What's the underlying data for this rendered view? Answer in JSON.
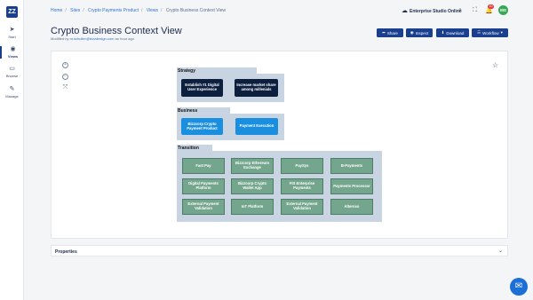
{
  "brand": {
    "logo": "ZZ"
  },
  "nav": [
    {
      "label": "Start",
      "icon": "send-icon"
    },
    {
      "label": "Views",
      "icon": "eye-icon"
    },
    {
      "label": "Browse",
      "icon": "folder-icon"
    },
    {
      "label": "Manage",
      "icon": "wrench-icon"
    }
  ],
  "breadcrumb": [
    "Home",
    "Sites",
    "Crypto Payments Product",
    "Views",
    "Crypto Business Context View"
  ],
  "topbar": {
    "studio": "Enterprise Studio Online",
    "notifications": "10",
    "avatar": "MS"
  },
  "page": {
    "title": "Crypto Business Context View",
    "modified_prefix": "Modified by",
    "modified_user": "m.schuller@bizzdesign.com",
    "modified_suffix": "an hour ago"
  },
  "actions": {
    "share": "Share",
    "inspect": "Inspect",
    "download": "Download",
    "workflow": "Workflow"
  },
  "diagram": {
    "strategy": {
      "title": "Strategy",
      "nodes": [
        "Establish #1 Digital User Experience",
        "Increase market share among millenials"
      ]
    },
    "business": {
      "title": "Business",
      "nodes": [
        "Bizzcorp Crypto Payment Product",
        "Payment Execution"
      ]
    },
    "transition": {
      "title": "Transition",
      "nodes": [
        "Fast Pay",
        "Bizzcorp Ethereum Exchange",
        "PaySys",
        "B-Payments",
        "Digital Payments Platform",
        "Bizzcorp Crypto Wallet App",
        "FIS Enterprise Payments",
        "Payments Processor",
        "External Payment Validation",
        "IoT Platform",
        "External Payment Validation",
        "Alternso"
      ]
    }
  },
  "properties": {
    "label": "Properties"
  }
}
